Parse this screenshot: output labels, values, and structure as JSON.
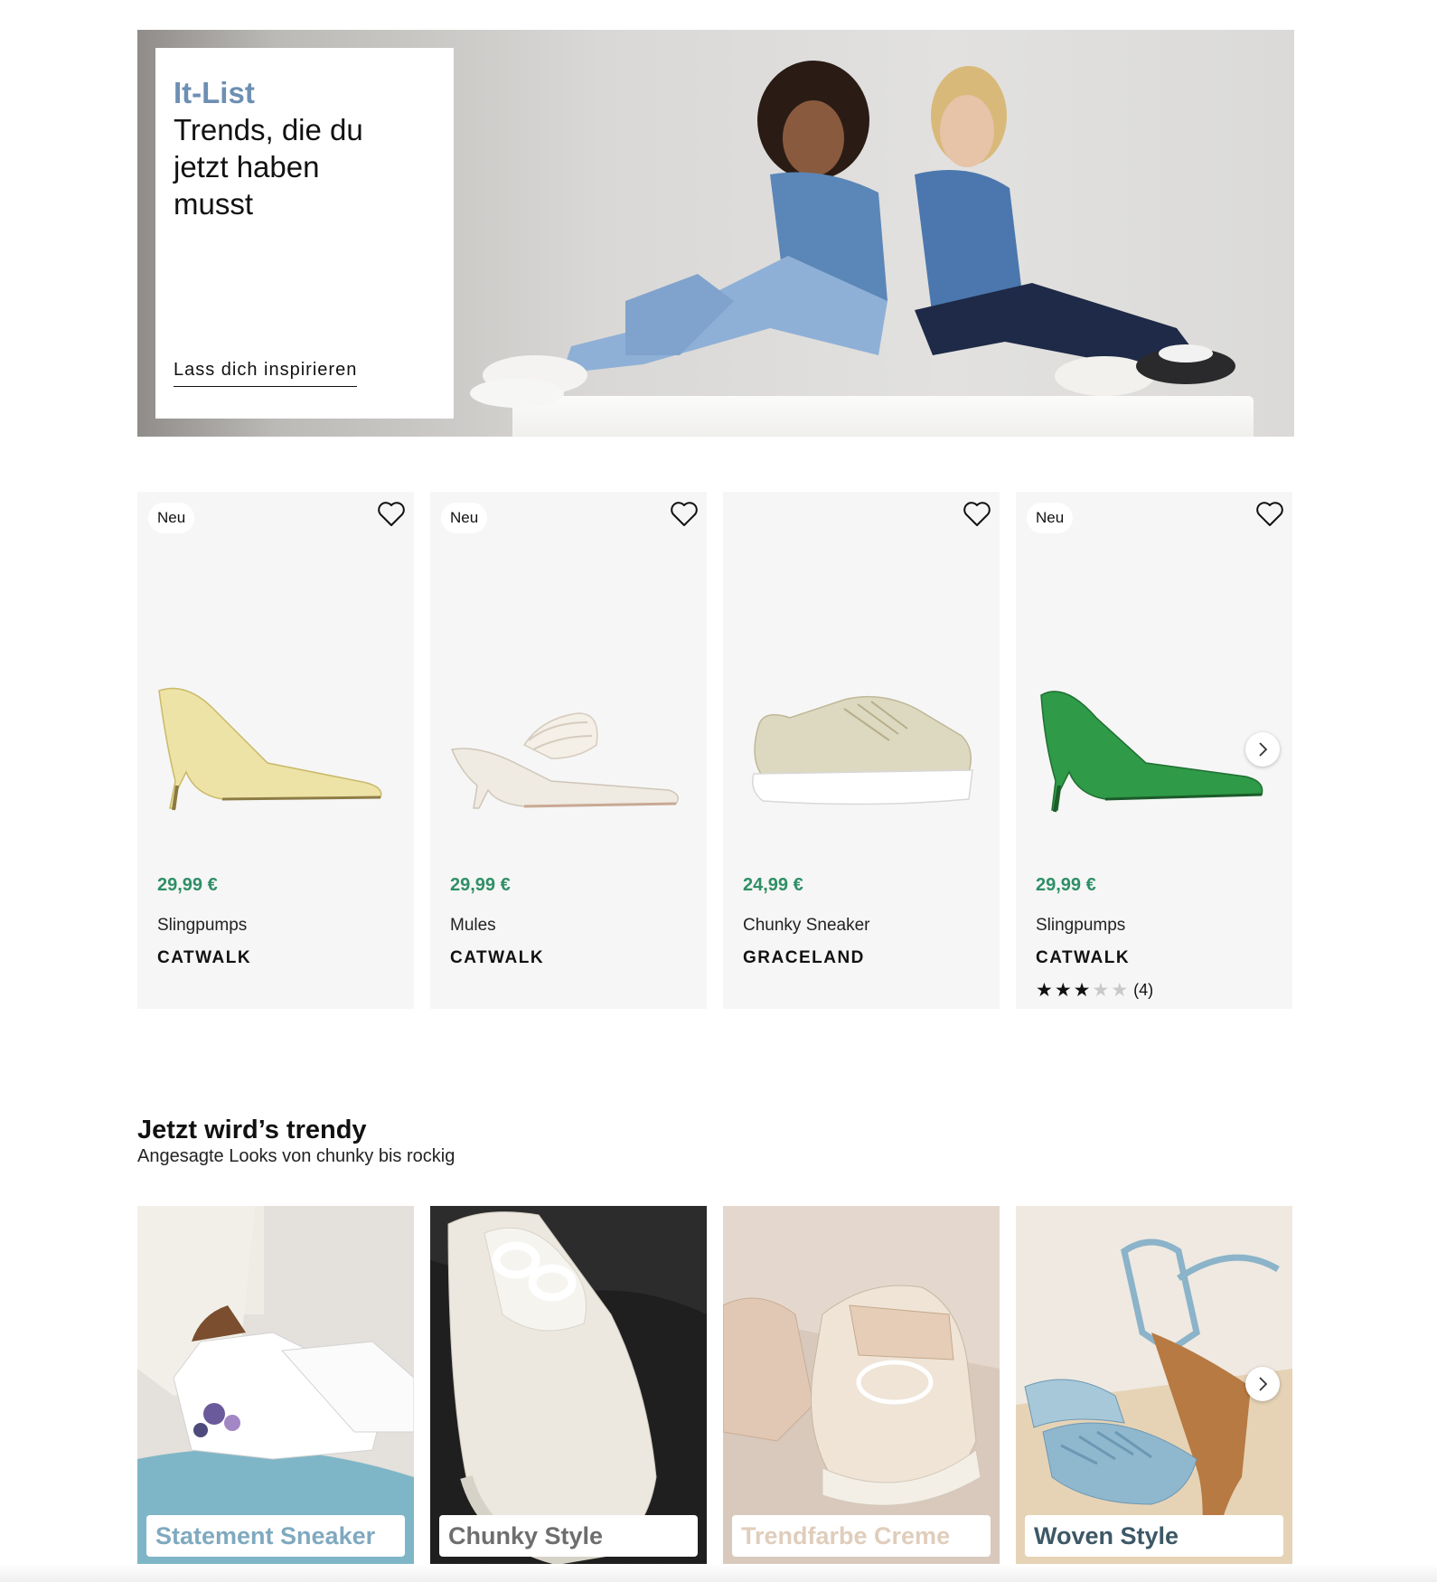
{
  "hero": {
    "kicker": "It-List",
    "title": "Trends, die du\njetzt haben\nmusst",
    "link_label": "Lass dich inspirieren"
  },
  "products": [
    {
      "badge": "Neu",
      "price": "29,99 €",
      "name": "Slingpumps",
      "brand": "CATWALK",
      "color": "#eee3a6",
      "icon": "heart-outline-icon"
    },
    {
      "badge": "Neu",
      "price": "29,99 €",
      "name": "Mules",
      "brand": "CATWALK",
      "color": "#efeae2",
      "icon": "heart-outline-icon"
    },
    {
      "badge": "",
      "price": "24,99 €",
      "name": "Chunky Sneaker",
      "brand": "GRACELAND",
      "color": "#ddd8c0",
      "icon": "heart-outline-icon"
    },
    {
      "badge": "Neu",
      "price": "29,99 €",
      "name": "Slingpumps",
      "brand": "CATWALK",
      "color": "#2f9a47",
      "icon": "heart-outline-icon",
      "rating": {
        "stars": 3,
        "max": 5,
        "count": "(4)"
      }
    }
  ],
  "trend_section": {
    "title": "Jetzt wird’s trendy",
    "subtitle": "Angesagte Looks von chunky bis rockig"
  },
  "tiles": [
    {
      "label": "Statement Sneaker",
      "label_color": "#7fa9bf"
    },
    {
      "label": "Chunky Style",
      "label_color": "#6e6e6e"
    },
    {
      "label": "Trendfarbe Creme",
      "label_color": "#e0cdbb"
    },
    {
      "label": "Woven Style",
      "label_color": "#3d5866"
    }
  ],
  "colors": {
    "price_green": "#2f8f67",
    "hero_accent": "#6d8fb3"
  }
}
